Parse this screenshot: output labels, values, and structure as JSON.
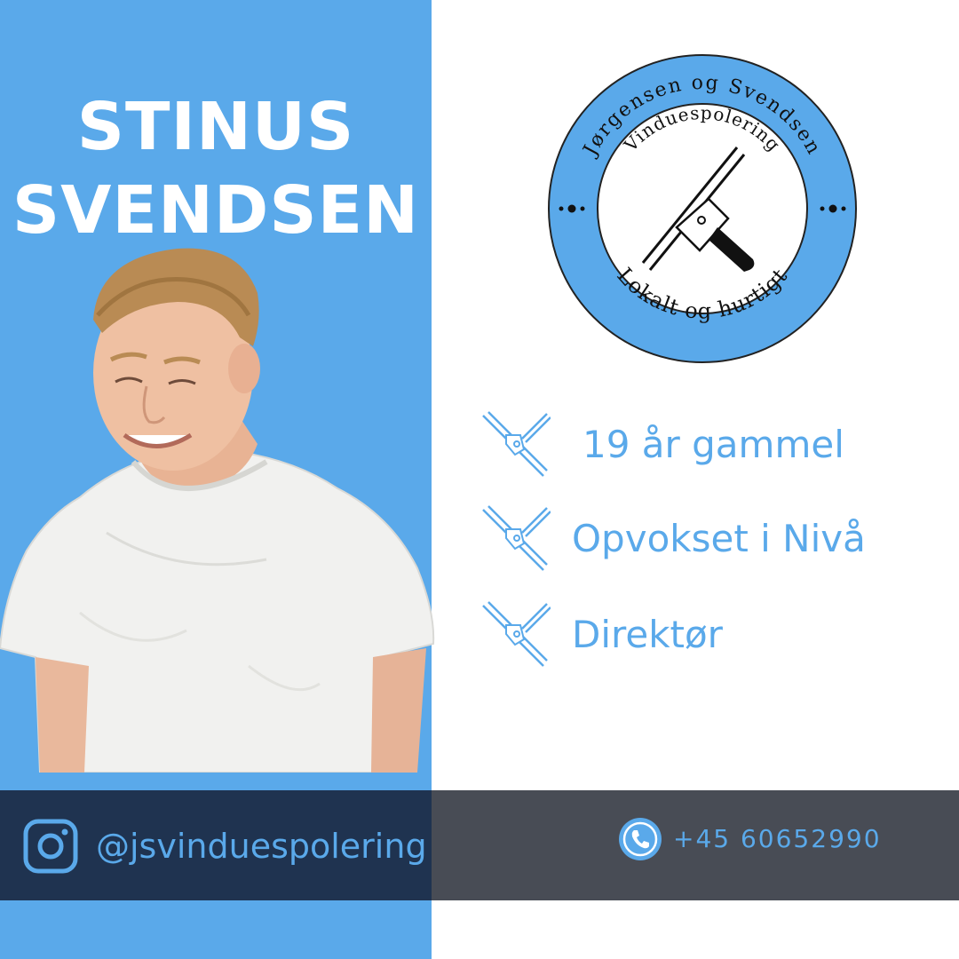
{
  "profile": {
    "first_name": "STINUS",
    "last_name": "SVENDSEN"
  },
  "logo": {
    "top_text": "Jørgensen og Svendsen",
    "middle_text": "Vinduespolering",
    "bottom_text": "Lokalt og hurtigt",
    "icon": "squeegee-icon"
  },
  "facts": [
    {
      "icon": "squeegee-icon",
      "text": "19 år gammel"
    },
    {
      "icon": "squeegee-icon",
      "text": "Opvokset i Nivå"
    },
    {
      "icon": "squeegee-icon",
      "text": "Direktør"
    }
  ],
  "footer": {
    "instagram_icon": "instagram-icon",
    "instagram_handle": "@jsvinduespolering",
    "phone_icon": "phone-icon",
    "phone": "+45 60652990"
  },
  "colors": {
    "accent_blue": "#5aa9ea",
    "navy": "#1f3350",
    "dark_gray": "#484c55",
    "white": "#ffffff"
  }
}
